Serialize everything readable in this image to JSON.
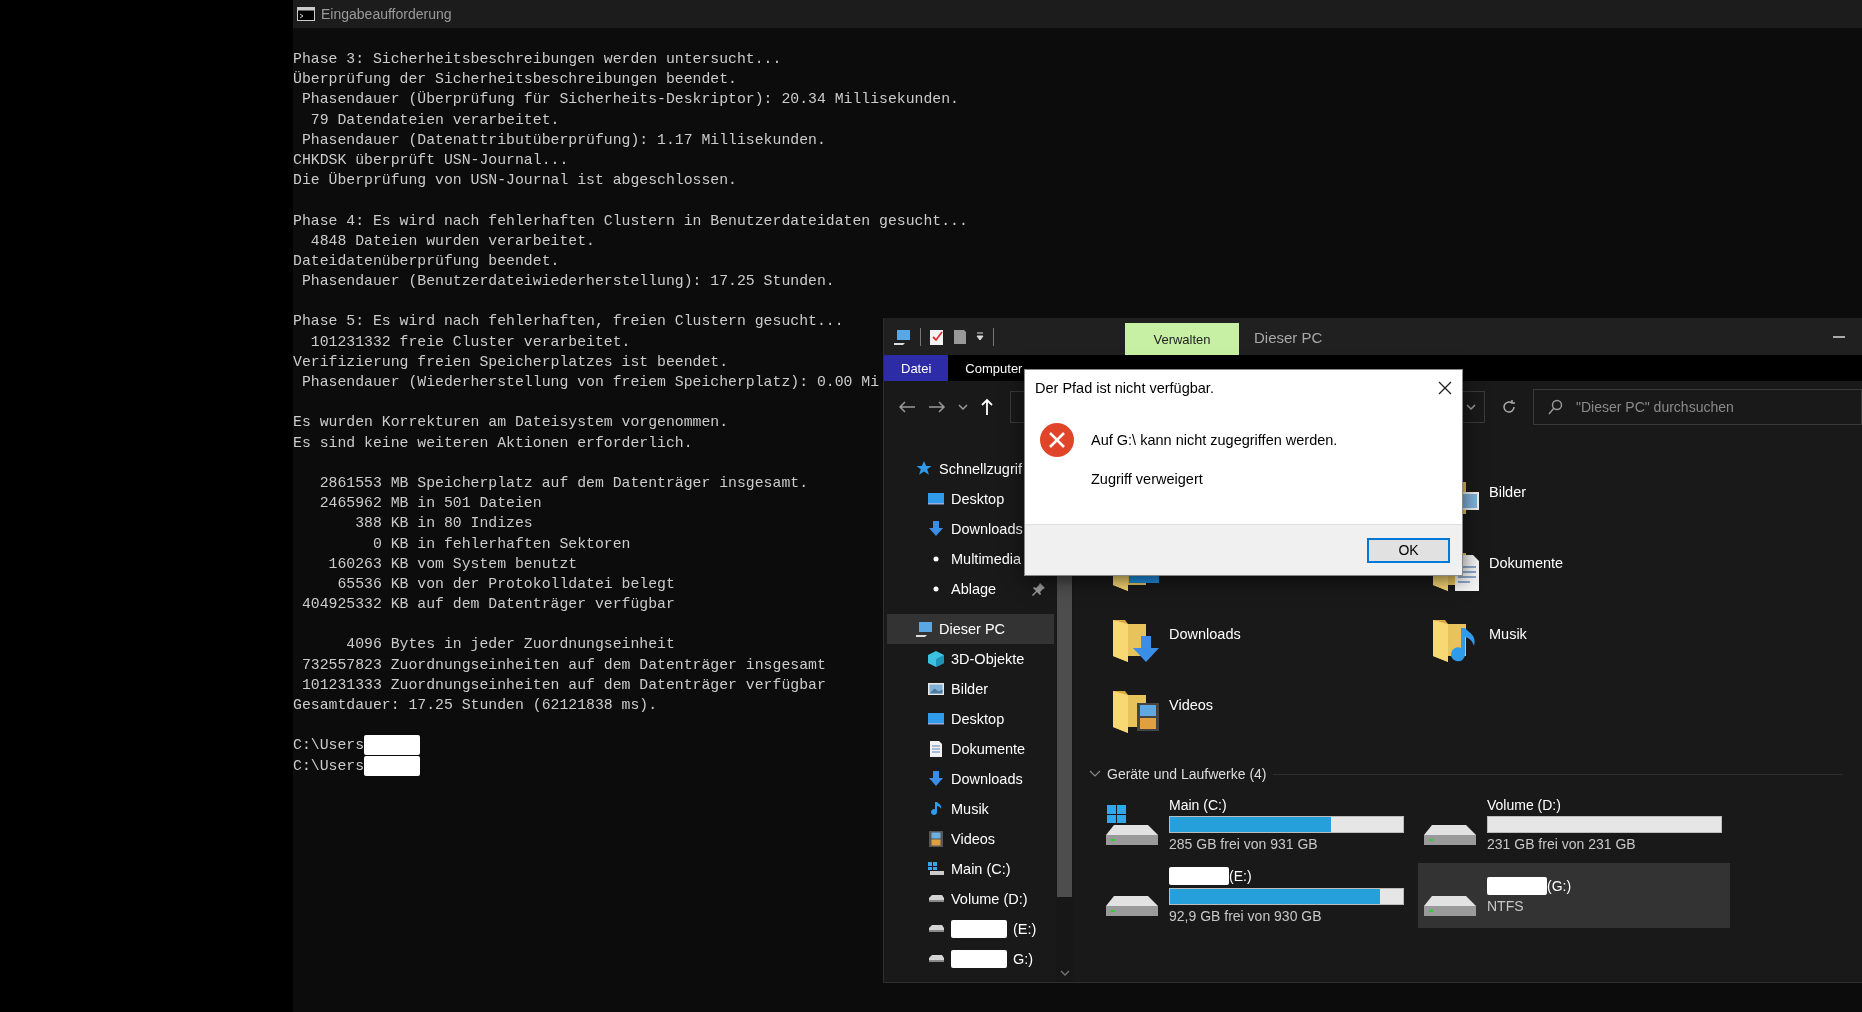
{
  "cmd": {
    "title": "Eingabeaufforderung",
    "blocks": [
      [
        "Phase 3: Sicherheitsbeschreibungen werden untersucht...",
        "Überprüfung der Sicherheitsbeschreibungen beendet.",
        " Phasendauer (Überprüfung für Sicherheits-Deskriptor): 20.34 Millisekunden.",
        "  79 Datendateien verarbeitet.",
        " Phasendauer (Datenattributüberprüfung): 1.17 Millisekunden.",
        "CHKDSK überprüft USN-Journal...",
        "Die Überprüfung von USN-Journal ist abgeschlossen."
      ],
      [
        "Phase 4: Es wird nach fehlerhaften Clustern in Benutzerdateidaten gesucht...",
        "  4848 Dateien wurden verarbeitet.",
        "Dateidatenüberprüfung beendet.",
        " Phasendauer (Benutzerdateiwiederherstellung): 17.25 Stunden."
      ],
      [
        "Phase 5: Es wird nach fehlerhaften, freien Clustern gesucht...",
        "  101231332 freie Cluster verarbeitet.",
        "Verifizierung freien Speicherplatzes ist beendet.",
        " Phasendauer (Wiederherstellung von freiem Speicherplatz): 0.00 Mi"
      ],
      [
        "Es wurden Korrekturen am Dateisystem vorgenommen.",
        "Es sind keine weiteren Aktionen erforderlich."
      ],
      [
        "   2861553 MB Speicherplatz auf dem Datenträger insgesamt.",
        "   2465962 MB in 501 Dateien",
        "       388 KB in 80 Indizes",
        "         0 KB in fehlerhaften Sektoren",
        "    160263 KB vom System benutzt",
        "     65536 KB von der Protokolldatei belegt",
        " 404925332 KB auf dem Datenträger verfügbar"
      ],
      [
        "      4096 Bytes in jeder Zuordnungseinheit",
        " 732557823 Zuordnungseinheiten auf dem Datenträger insgesamt",
        " 101231333 Zuordnungseinheiten auf dem Datenträger verfügbar",
        "Gesamtdauer: 17.25 Stunden (62121838 ms)."
      ]
    ],
    "prompts": [
      {
        "text": "C:\\Users",
        "redacted": true
      },
      {
        "text": "C:\\Users",
        "redacted": true
      }
    ]
  },
  "explorer": {
    "context_tab": "Verwalten",
    "title": "Dieser PC",
    "ribbon_tabs": [
      {
        "label": "Datei",
        "selected": true
      },
      {
        "label": "Computer",
        "selected": false
      }
    ],
    "search": {
      "placeholder": "\"Dieser PC\" durchsuchen"
    },
    "nav": [
      {
        "label": "Schnellzugrif",
        "kind": "star",
        "selected": false,
        "children": [
          {
            "label": "Desktop",
            "kind": "desktop",
            "selected": false
          },
          {
            "label": "Downloads",
            "kind": "download",
            "selected": false
          },
          {
            "label": "Multimedia",
            "kind": "dot",
            "selected": false
          },
          {
            "label": "Ablage",
            "kind": "dot",
            "selected": false,
            "pinned": true
          }
        ]
      },
      {
        "label": "Dieser PC",
        "kind": "pc",
        "selected": true,
        "children": [
          {
            "label": "3D-Objekte",
            "kind": "cube",
            "selected": false
          },
          {
            "label": "Bilder",
            "kind": "picture",
            "selected": false
          },
          {
            "label": "Desktop",
            "kind": "desktop",
            "selected": false
          },
          {
            "label": "Dokumente",
            "kind": "document",
            "selected": false
          },
          {
            "label": "Downloads",
            "kind": "download",
            "selected": false
          },
          {
            "label": "Musik",
            "kind": "music",
            "selected": false
          },
          {
            "label": "Videos",
            "kind": "video",
            "selected": false
          },
          {
            "label": "Main (C:)",
            "kind": "windrive",
            "selected": false
          },
          {
            "label": "Volume (D:)",
            "kind": "drive",
            "selected": false
          },
          {
            "label": "(E:)",
            "kind": "drive",
            "selected": false,
            "redacted": true
          },
          {
            "label": "G:)",
            "kind": "drive",
            "selected": false,
            "redacted": true
          }
        ]
      }
    ],
    "folders": [
      {
        "label": "Bilder",
        "kind": "picture"
      },
      {
        "kind": "desktop"
      },
      {
        "label": "Dokumente",
        "kind": "document"
      },
      {
        "label": "Downloads",
        "kind": "download"
      },
      {
        "label": "Musik",
        "kind": "music"
      },
      {
        "label": "Videos",
        "kind": "video"
      }
    ],
    "drives_header": "Geräte und Laufwerke (4)",
    "drives": [
      {
        "kind": "system",
        "label": "Main (C:)",
        "level": 0.69,
        "free": "285 GB frei von 931 GB",
        "selected": false
      },
      {
        "kind": "data",
        "label": "Volume (D:)",
        "free": "231 GB frei von 231 GB",
        "selected": false
      },
      {
        "kind": "data",
        "label": "(E:)",
        "redacted": true,
        "level": 0.9,
        "free": "92,9 GB frei von 930 GB",
        "selected": false
      },
      {
        "kind": "filesystem",
        "label": "(G:)",
        "redacted": true,
        "filesystem": "NTFS",
        "selected": true
      }
    ]
  },
  "dialog": {
    "title": "Der Pfad ist nicht verfügbar.",
    "message": "Auf G:\\ kann nicht zugegriffen werden.",
    "detail": "Zugriff verweigert",
    "button": "OK"
  }
}
